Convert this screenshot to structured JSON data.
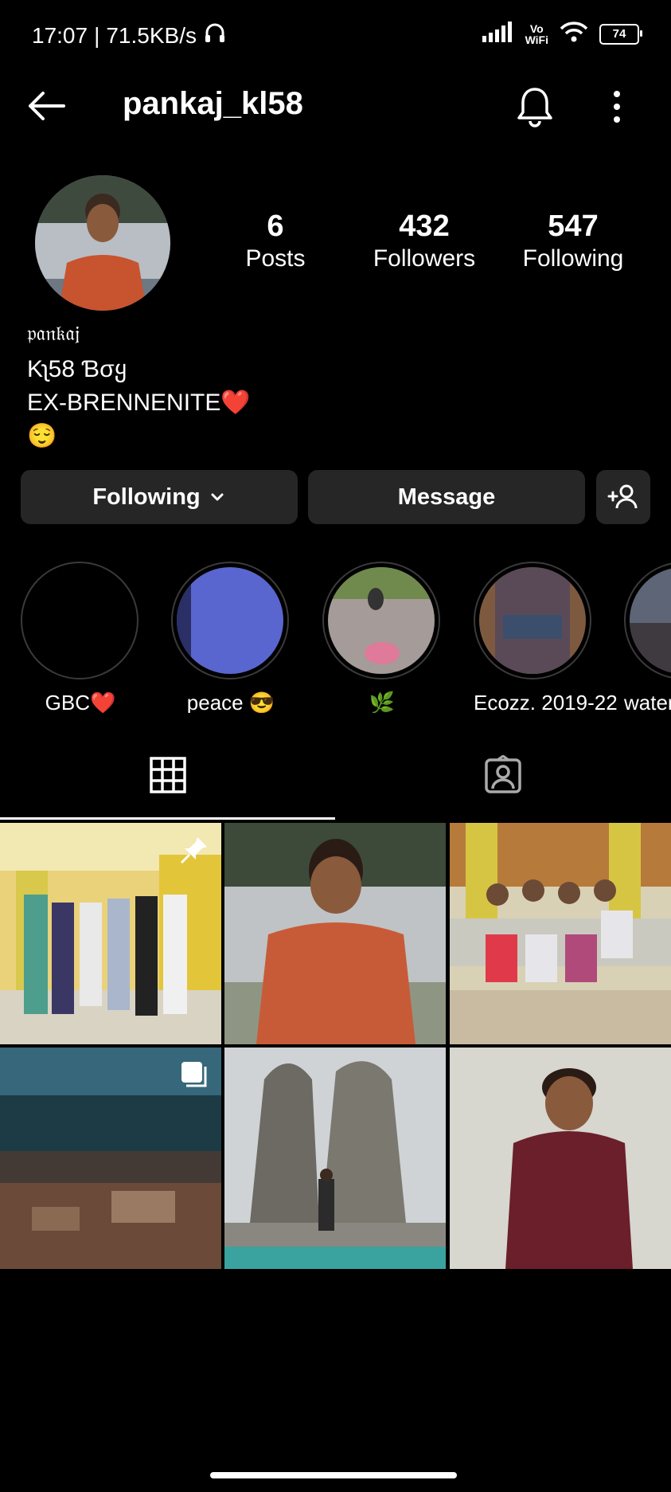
{
  "status_bar": {
    "time": "17:07",
    "speed": "71.5KB/s",
    "vowifi_top": "Vo",
    "vowifi_bottom": "WiFi",
    "battery": "74"
  },
  "header": {
    "username": "pankaj_kl58"
  },
  "profile": {
    "posts_count": "6",
    "posts_label": "Posts",
    "followers_count": "432",
    "followers_label": "Followers",
    "following_count": "547",
    "following_label": "Following"
  },
  "bio": {
    "name": "𝔭𝔞𝔫𝔨𝔞𝔧",
    "line1": "Kʅ58 Ɓσყ",
    "line2": "EX-BRENNENITE❤️",
    "line3": "😌"
  },
  "actions": {
    "following_label": "Following",
    "message_label": "Message"
  },
  "highlights": [
    {
      "label": "GBC❤️"
    },
    {
      "label": "peace 😎"
    },
    {
      "label": "🌿"
    },
    {
      "label": "Ecozz. 2019-22"
    },
    {
      "label": "water"
    }
  ],
  "colors": {
    "background": "#000000",
    "button_bg": "#262626",
    "text": "#ffffff"
  }
}
